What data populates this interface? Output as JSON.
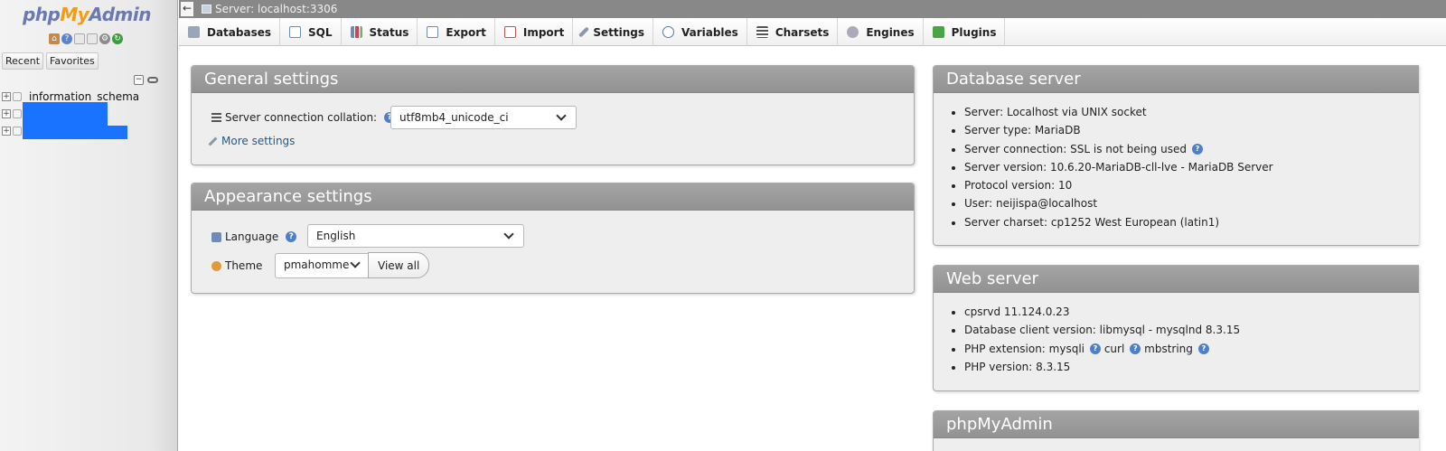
{
  "sidebar": {
    "logo": {
      "php": "php",
      "my": "My",
      "admin": "Admin"
    },
    "nav_icons": [
      "home-icon",
      "help-icon",
      "docs-icon",
      "sql-docs-icon",
      "gear-icon",
      "reload-icon"
    ],
    "tabs": [
      {
        "label": "Recent"
      },
      {
        "label": "Favorites"
      }
    ],
    "tree": [
      {
        "label": "information_schema"
      },
      {
        "label": ""
      },
      {
        "label": ""
      }
    ]
  },
  "topbar": {
    "server_label": "Server: localhost:3306"
  },
  "menu": [
    {
      "label": "Databases",
      "icon": "databases-icon"
    },
    {
      "label": "SQL",
      "icon": "sql-icon"
    },
    {
      "label": "Status",
      "icon": "status-icon"
    },
    {
      "label": "Export",
      "icon": "export-icon"
    },
    {
      "label": "Import",
      "icon": "import-icon"
    },
    {
      "label": "Settings",
      "icon": "wrench-icon"
    },
    {
      "label": "Variables",
      "icon": "variables-icon"
    },
    {
      "label": "Charsets",
      "icon": "charsets-icon"
    },
    {
      "label": "Engines",
      "icon": "engines-icon"
    },
    {
      "label": "Plugins",
      "icon": "plugins-icon"
    }
  ],
  "general_settings": {
    "title": "General settings",
    "collation_label": "Server connection collation:",
    "collation_value": "utf8mb4_unicode_ci",
    "more_settings": "More settings"
  },
  "appearance_settings": {
    "title": "Appearance settings",
    "language_label": "Language",
    "language_value": "English",
    "theme_label": "Theme",
    "theme_value": "pmahomme",
    "view_all": "View all"
  },
  "database_server": {
    "title": "Database server",
    "items": [
      "Server: Localhost via UNIX socket",
      "Server type: MariaDB",
      "Server connection: SSL is not being used",
      "Server version: 10.6.20-MariaDB-cll-lve - MariaDB Server",
      "Protocol version: 10",
      "User: neijispa@localhost",
      "Server charset: cp1252 West European (latin1)"
    ]
  },
  "web_server": {
    "title": "Web server",
    "items": [
      "cpsrvd 11.124.0.23",
      "Database client version: libmysql - mysqlnd 8.3.15",
      "PHP extension: mysqli",
      "curl",
      "mbstring",
      "PHP version: 8.3.15"
    ]
  },
  "phpmyadmin_panel": {
    "title": "phpMyAdmin"
  },
  "colors": {
    "accent_link": "#235a81",
    "panel_header": "#999999",
    "redaction": "#1a73ff"
  }
}
